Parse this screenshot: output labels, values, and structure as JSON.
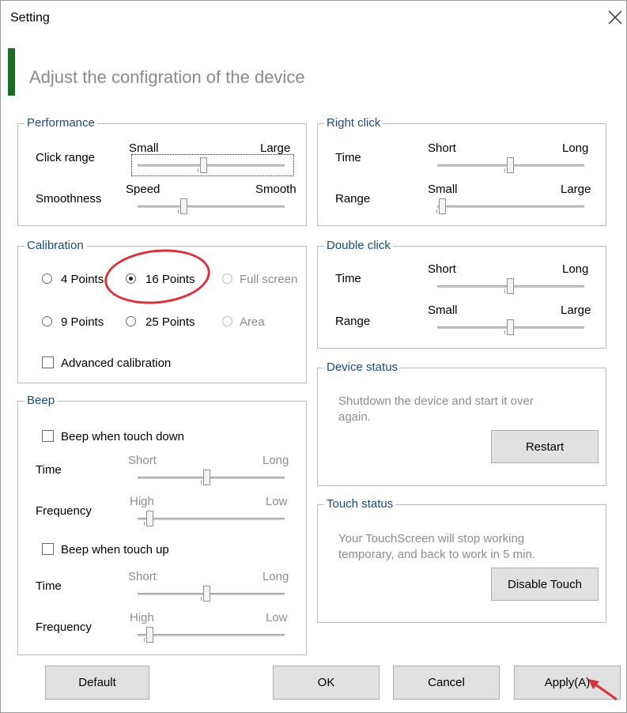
{
  "window": {
    "title": "Setting"
  },
  "header": {
    "subtitle": "Adjust the configration of the device"
  },
  "colors": {
    "accent": "#1e6b25",
    "group_title": "#1a4a78",
    "annotation": "#d9323a"
  },
  "performance": {
    "title": "Performance",
    "click_range": {
      "label": "Click range",
      "min": "Small",
      "max": "Large",
      "level": 0.45
    },
    "smoothness": {
      "label": "Smoothness",
      "min": "Speed",
      "max": "Smooth",
      "level": 0.3
    }
  },
  "right_click": {
    "title": "Right click",
    "time": {
      "label": "Time",
      "min": "Short",
      "max": "Long",
      "level": 0.5
    },
    "range": {
      "label": "Range",
      "min": "Small",
      "max": "Large",
      "level": 0.0
    }
  },
  "calibration": {
    "title": "Calibration",
    "options": [
      "4 Points",
      "16 Points",
      "Full screen",
      "9 Points",
      "25 Points",
      "Area"
    ],
    "selected": "16 Points",
    "advanced_label": "Advanced calibration"
  },
  "double_click": {
    "title": "Double click",
    "time": {
      "label": "Time",
      "min": "Short",
      "max": "Long",
      "level": 0.5
    },
    "range": {
      "label": "Range",
      "min": "Small",
      "max": "Large",
      "level": 0.5
    }
  },
  "device_status": {
    "title": "Device status",
    "text_line1": "Shutdown the device and start it over",
    "text_line2": "again.",
    "restart_label": "Restart"
  },
  "beep": {
    "title": "Beep",
    "down_label": "Beep when touch down",
    "up_label": "Beep when touch up",
    "time_label": "Time",
    "freq_label": "Frequency",
    "short": "Short",
    "long": "Long",
    "high": "High",
    "low": "Low",
    "down_time_level": 0.47,
    "down_freq_level": 0.05,
    "up_time_level": 0.47,
    "up_freq_level": 0.05
  },
  "touch_status": {
    "title": "Touch status",
    "text_line1": "Your TouchScreen will stop working",
    "text_line2": "temporary, and back to work in 5 min.",
    "disable_label": "Disable Touch"
  },
  "footer": {
    "default_label": "Default",
    "ok_label": "OK",
    "cancel_label": "Cancel",
    "apply_label": "Apply(A)"
  }
}
